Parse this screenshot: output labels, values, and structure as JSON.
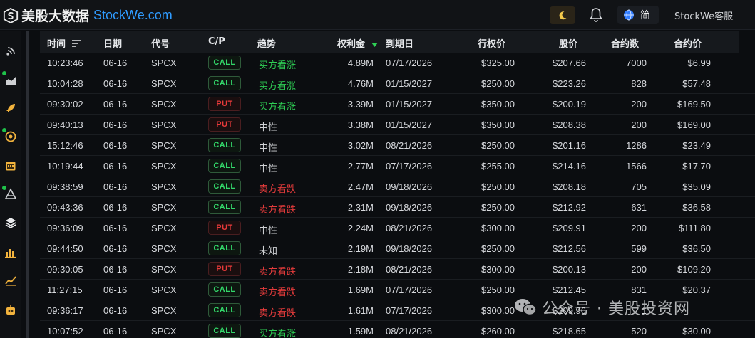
{
  "header": {
    "brand_cn": "美股大数据",
    "brand_en": "StockWe.com",
    "lang": "简",
    "service": "StockWe客服",
    "icons": [
      "logo-mark",
      "moon-icon",
      "bell-icon",
      "globe-icon"
    ]
  },
  "sidebar": {
    "icons": [
      "signal-icon",
      "area-chart-icon",
      "rocket-icon",
      "target-icon",
      "calendar-icon",
      "pyramid-icon",
      "layers-icon",
      "bar-chart-icon",
      "line-chart-icon",
      "robot-icon"
    ]
  },
  "table": {
    "columns": {
      "time": "时间",
      "date": "日期",
      "symbol": "代号",
      "cp": "C/P",
      "trend": "趋势",
      "premium": "权利金",
      "expiry": "到期日",
      "strike": "行权价",
      "stock": "股价",
      "contracts": "合约数",
      "price": "合约价"
    },
    "rows": [
      {
        "time": "10:23:46",
        "date": "06-16",
        "symbol": "SPCX",
        "cp": "CALL",
        "trend": "买方看涨",
        "premium": "4.89M",
        "expiry": "07/17/2026",
        "strike": "$325.00",
        "stock": "$207.66",
        "contracts": "7000",
        "price": "$6.99"
      },
      {
        "time": "10:04:28",
        "date": "06-16",
        "symbol": "SPCX",
        "cp": "CALL",
        "trend": "买方看涨",
        "premium": "4.76M",
        "expiry": "01/15/2027",
        "strike": "$250.00",
        "stock": "$223.26",
        "contracts": "828",
        "price": "$57.48"
      },
      {
        "time": "09:30:02",
        "date": "06-16",
        "symbol": "SPCX",
        "cp": "PUT",
        "trend": "买方看涨",
        "premium": "3.39M",
        "expiry": "01/15/2027",
        "strike": "$350.00",
        "stock": "$200.19",
        "contracts": "200",
        "price": "$169.50"
      },
      {
        "time": "09:40:13",
        "date": "06-16",
        "symbol": "SPCX",
        "cp": "PUT",
        "trend": "中性",
        "premium": "3.38M",
        "expiry": "01/15/2027",
        "strike": "$350.00",
        "stock": "$208.38",
        "contracts": "200",
        "price": "$169.00"
      },
      {
        "time": "15:12:46",
        "date": "06-16",
        "symbol": "SPCX",
        "cp": "CALL",
        "trend": "中性",
        "premium": "3.02M",
        "expiry": "08/21/2026",
        "strike": "$250.00",
        "stock": "$201.16",
        "contracts": "1286",
        "price": "$23.49"
      },
      {
        "time": "10:19:44",
        "date": "06-16",
        "symbol": "SPCX",
        "cp": "CALL",
        "trend": "中性",
        "premium": "2.77M",
        "expiry": "07/17/2026",
        "strike": "$255.00",
        "stock": "$214.16",
        "contracts": "1566",
        "price": "$17.70"
      },
      {
        "time": "09:38:59",
        "date": "06-16",
        "symbol": "SPCX",
        "cp": "CALL",
        "trend": "卖方看跌",
        "premium": "2.47M",
        "expiry": "09/18/2026",
        "strike": "$250.00",
        "stock": "$208.18",
        "contracts": "705",
        "price": "$35.09"
      },
      {
        "time": "09:43:36",
        "date": "06-16",
        "symbol": "SPCX",
        "cp": "CALL",
        "trend": "卖方看跌",
        "premium": "2.31M",
        "expiry": "09/18/2026",
        "strike": "$250.00",
        "stock": "$212.92",
        "contracts": "631",
        "price": "$36.58"
      },
      {
        "time": "09:36:09",
        "date": "06-16",
        "symbol": "SPCX",
        "cp": "PUT",
        "trend": "中性",
        "premium": "2.24M",
        "expiry": "08/21/2026",
        "strike": "$300.00",
        "stock": "$209.91",
        "contracts": "200",
        "price": "$111.80"
      },
      {
        "time": "09:44:50",
        "date": "06-16",
        "symbol": "SPCX",
        "cp": "CALL",
        "trend": "未知",
        "premium": "2.19M",
        "expiry": "09/18/2026",
        "strike": "$250.00",
        "stock": "$212.56",
        "contracts": "599",
        "price": "$36.50"
      },
      {
        "time": "09:30:05",
        "date": "06-16",
        "symbol": "SPCX",
        "cp": "PUT",
        "trend": "卖方看跌",
        "premium": "2.18M",
        "expiry": "08/21/2026",
        "strike": "$300.00",
        "stock": "$200.13",
        "contracts": "200",
        "price": "$109.20"
      },
      {
        "time": "11:27:15",
        "date": "06-16",
        "symbol": "SPCX",
        "cp": "CALL",
        "trend": "卖方看跌",
        "premium": "1.69M",
        "expiry": "07/17/2026",
        "strike": "$250.00",
        "stock": "$212.45",
        "contracts": "831",
        "price": "$20.37"
      },
      {
        "time": "09:36:17",
        "date": "06-16",
        "symbol": "SPCX",
        "cp": "CALL",
        "trend": "卖方看跌",
        "premium": "1.61M",
        "expiry": "07/17/2026",
        "strike": "$300.00",
        "stock": "$209.96",
        "contracts": "1",
        "price": ""
      },
      {
        "time": "10:07:52",
        "date": "06-16",
        "symbol": "SPCX",
        "cp": "CALL",
        "trend": "买方看涨",
        "premium": "1.59M",
        "expiry": "08/21/2026",
        "strike": "$260.00",
        "stock": "$218.65",
        "contracts": "520",
        "price": "$30.00"
      }
    ]
  },
  "watermark": {
    "text": "公众号 · 美股投资网"
  },
  "colors": {
    "accent": "#2f9bff",
    "up": "#2fcf55",
    "down": "#e33b3b",
    "call": "#33d86a",
    "put": "#e83a3a",
    "status_dot": "#1fc24a"
  }
}
